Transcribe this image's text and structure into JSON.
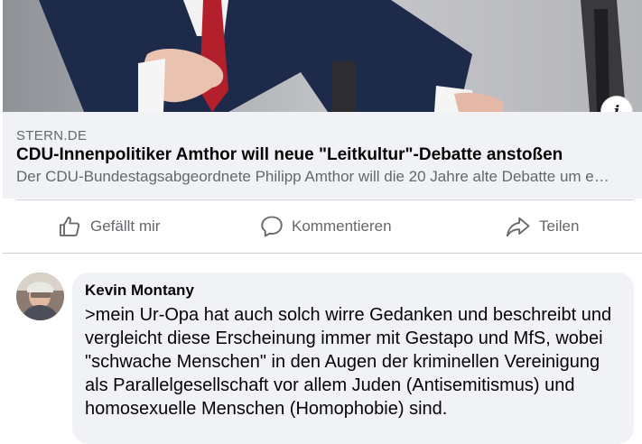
{
  "link_preview": {
    "info_icon_glyph": "i",
    "domain": "STERN.DE",
    "title": "CDU-Innenpolitiker Amthor will neue \"Leitkultur\"-Debatte anstoßen",
    "description": "Der CDU-Bundestagsabgeordnete Philipp Amthor will die 20 Jahre alte Debatte um e…"
  },
  "actions": {
    "like": {
      "label": "Gefällt mir",
      "icon": "thumbs-up-icon"
    },
    "comment": {
      "label": "Kommentieren",
      "icon": "speech-bubble-icon"
    },
    "share": {
      "label": "Teilen",
      "icon": "share-arrow-icon"
    }
  },
  "comment": {
    "author": "Kevin Montany",
    "text": ">mein Ur-Opa hat auch solch wirre Gedanken und beschreibt und vergleicht diese Erscheinung immer mit Gestapo und MfS, wobei \"schwache Menschen\" in den Augen der kriminellen Vereinigung als Parallelgesellschaft vor allem Juden (Antisemitismus) und homosexuelle Menschen (Homophobie) sind."
  },
  "colors": {
    "meta_background": "#f0f2f5",
    "secondary_text": "#65676b",
    "primary_text": "#050505",
    "divider": "#ced0d4"
  }
}
